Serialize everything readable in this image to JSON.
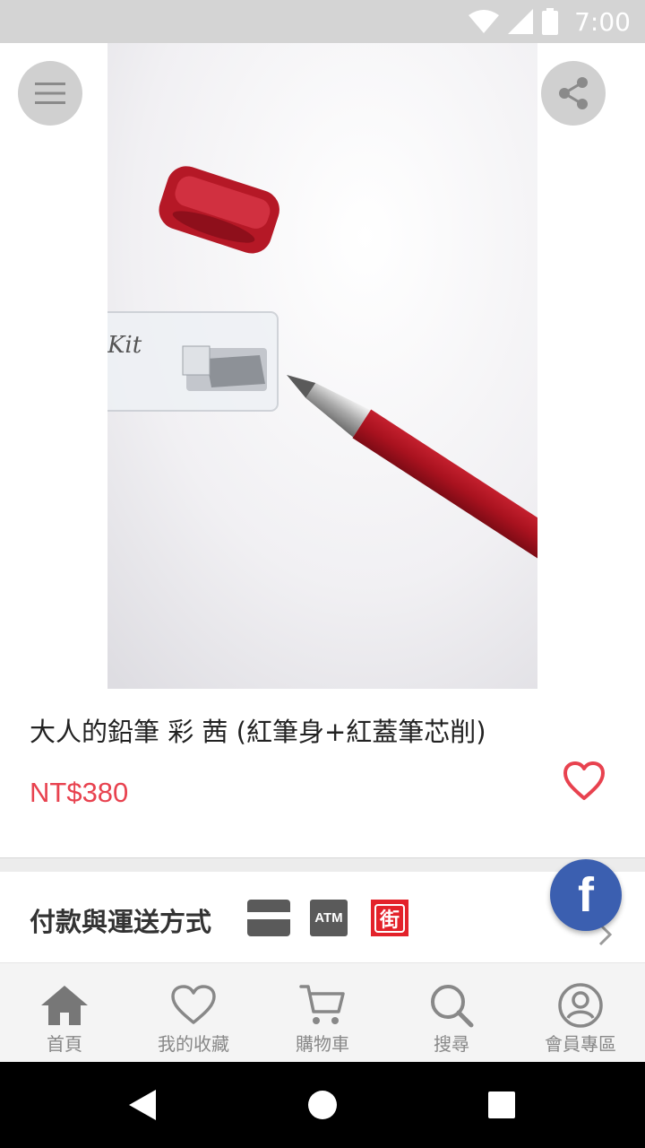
{
  "status_bar": {
    "time": "7:00"
  },
  "product": {
    "image_alt": "Kita-Boshi red pencil with cap and sharpener",
    "title": "大人的鉛筆 彩 茜 (紅筆身+紅蓋筆芯削)",
    "price": "NT$380"
  },
  "payment": {
    "title": "付款與運送方式",
    "atm_label": "ATM",
    "store_label": "街"
  },
  "fb": {
    "label": "f"
  },
  "nav": {
    "items": [
      {
        "label": "首頁",
        "icon": "home-icon"
      },
      {
        "label": "我的收藏",
        "icon": "heart-icon"
      },
      {
        "label": "購物車",
        "icon": "cart-icon"
      },
      {
        "label": "搜尋",
        "icon": "search-icon"
      },
      {
        "label": "會員專區",
        "icon": "user-icon"
      }
    ]
  },
  "colors": {
    "accent": "#e8424f",
    "facebook": "#3b5fb0",
    "store": "#e3222a"
  }
}
